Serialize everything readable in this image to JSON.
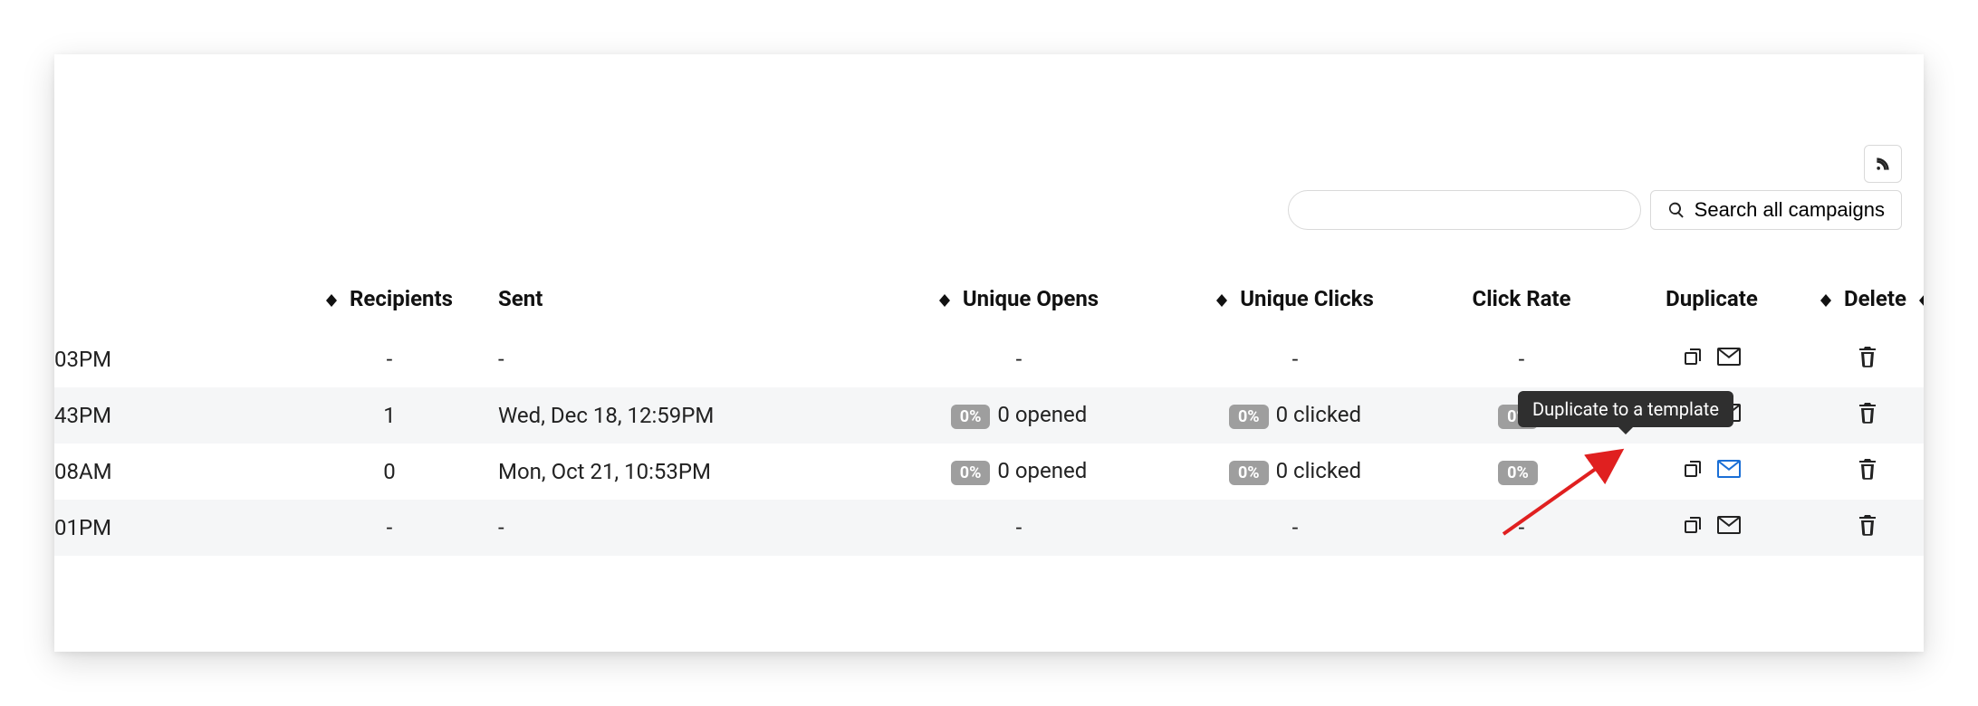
{
  "toolbar": {
    "search_placeholder": "",
    "search_button_label": "Search all campaigns"
  },
  "tooltip_text": "Duplicate to a template",
  "columns": {
    "recipients": "Recipients",
    "sent": "Sent",
    "unique_opens": "Unique Opens",
    "unique_clicks": "Unique Clicks",
    "click_rate": "Click Rate",
    "duplicate": "Duplicate",
    "delete": "Delete"
  },
  "rows": [
    {
      "time": "03PM",
      "recipients": "-",
      "sent": "-",
      "opens_badge": "",
      "opens_text": "-",
      "clicks_badge": "",
      "clicks_text": "-",
      "rate_badge": "",
      "rate_text": "-",
      "env_color": "#222"
    },
    {
      "time": "43PM",
      "recipients": "1",
      "sent": "Wed, Dec 18, 12:59PM",
      "opens_badge": "0%",
      "opens_text": "0 opened",
      "clicks_badge": "0%",
      "clicks_text": "0 clicked",
      "rate_badge": "0%",
      "rate_text": "",
      "env_color": "#222"
    },
    {
      "time": "08AM",
      "recipients": "0",
      "sent": "Mon, Oct 21, 10:53PM",
      "opens_badge": "0%",
      "opens_text": "0 opened",
      "clicks_badge": "0%",
      "clicks_text": "0 clicked",
      "rate_badge": "0%",
      "rate_text": "",
      "env_color": "#1a6fd6"
    },
    {
      "time": "01PM",
      "recipients": "-",
      "sent": "-",
      "opens_badge": "",
      "opens_text": "-",
      "clicks_badge": "",
      "clicks_text": "-",
      "rate_badge": "",
      "rate_text": "-",
      "env_color": "#222"
    }
  ]
}
